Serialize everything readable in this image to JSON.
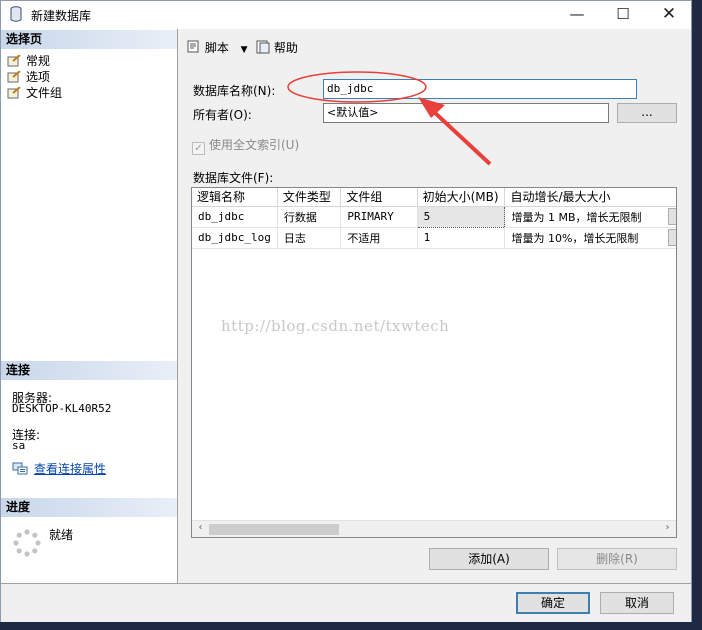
{
  "window": {
    "title": "新建数据库"
  },
  "titlebar": {
    "minimize": "—",
    "maximize": "☐",
    "close": "✕"
  },
  "left": {
    "select_page_header": "选择页",
    "pages": [
      {
        "label": "常规"
      },
      {
        "label": "选项"
      },
      {
        "label": "文件组"
      }
    ],
    "connection_header": "连接",
    "server_label": "服务器:",
    "server_value": "DESKTOP-KL40R52",
    "connection_label": "连接:",
    "connection_value": "sa",
    "view_props_link": "查看连接属性",
    "progress_header": "进度",
    "progress_status": "就绪"
  },
  "toolbar": {
    "script_label": "脚本",
    "help_label": "帮助"
  },
  "form": {
    "db_name_label": "数据库名称(N):",
    "db_name_value": "db_jdbc",
    "owner_label": "所有者(O):",
    "owner_value": "<默认值>",
    "owner_browse": "...",
    "fulltext_label": "使用全文索引(U)",
    "fulltext_checked": true,
    "files_label": "数据库文件(F):"
  },
  "grid": {
    "columns": [
      "逻辑名称",
      "文件类型",
      "文件组",
      "初始大小(MB)",
      "自动增长/最大大小"
    ],
    "rows": [
      [
        "db_jdbc",
        "行数据",
        "PRIMARY",
        "5",
        "增量为 1 MB，增长无限制"
      ],
      [
        "db_jdbc_log",
        "日志",
        "不适用",
        "1",
        "增量为 10%，增长无限制"
      ]
    ],
    "scroll_left": "‹",
    "scroll_right": "›"
  },
  "buttons": {
    "add": "添加(A)",
    "remove": "删除(R)",
    "ok": "确定",
    "cancel": "取消"
  },
  "watermark": "http://blog.csdn.net/txwtech",
  "colors": {
    "annotation": "#e8403a",
    "accent": "#3c7fb1",
    "link": "#0645ad"
  }
}
